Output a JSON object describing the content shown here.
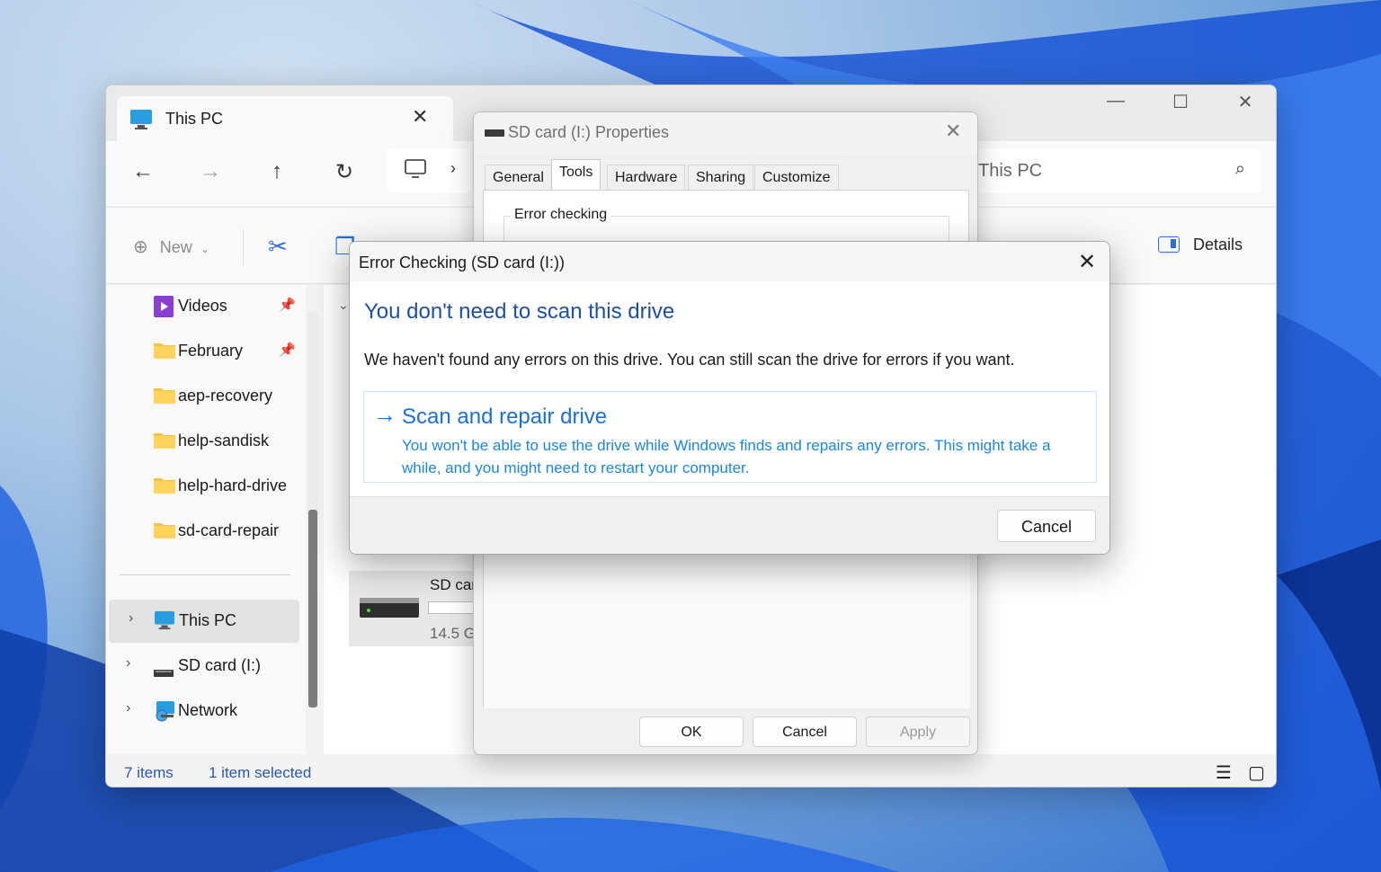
{
  "explorer": {
    "tab_title": "This PC",
    "address_text": "This PC",
    "toolbar": {
      "new_label": "New",
      "details_label": "Details"
    },
    "sidebar": {
      "items": [
        {
          "label": "Videos",
          "pinned": true
        },
        {
          "label": "February",
          "pinned": true
        },
        {
          "label": "aep-recovery"
        },
        {
          "label": "help-sandisk"
        },
        {
          "label": "help-hard-drive"
        },
        {
          "label": "sd-card-repair"
        }
      ],
      "locations": [
        {
          "label": "This PC",
          "selected": true
        },
        {
          "label": "SD card (I:)"
        },
        {
          "label": "Network"
        }
      ]
    },
    "drive_tile": {
      "name": "SD car",
      "size": "14.5 G"
    },
    "status": {
      "items": "7 items",
      "selected": "1 item selected"
    }
  },
  "properties": {
    "title": "SD card (I:) Properties",
    "tabs": [
      "General",
      "Tools",
      "Hardware",
      "Sharing",
      "Customize"
    ],
    "active_tab": "Tools",
    "group_label": "Error checking",
    "buttons": {
      "ok": "OK",
      "cancel": "Cancel",
      "apply": "Apply"
    }
  },
  "error_dialog": {
    "title": "Error Checking (SD card (I:))",
    "heading": "You don't need to scan this drive",
    "body": "We haven't found any errors on this drive. You can still scan the drive for errors if you want.",
    "scan_title": "Scan and repair drive",
    "scan_desc": "You won't be able to use the drive while Windows finds and repairs any errors. This might take a while, and you might need to restart your computer.",
    "cancel": "Cancel"
  },
  "colors": {
    "accent": "#1f6fd1",
    "heading": "#1d4f9c",
    "link_desc": "#1f86d9"
  }
}
